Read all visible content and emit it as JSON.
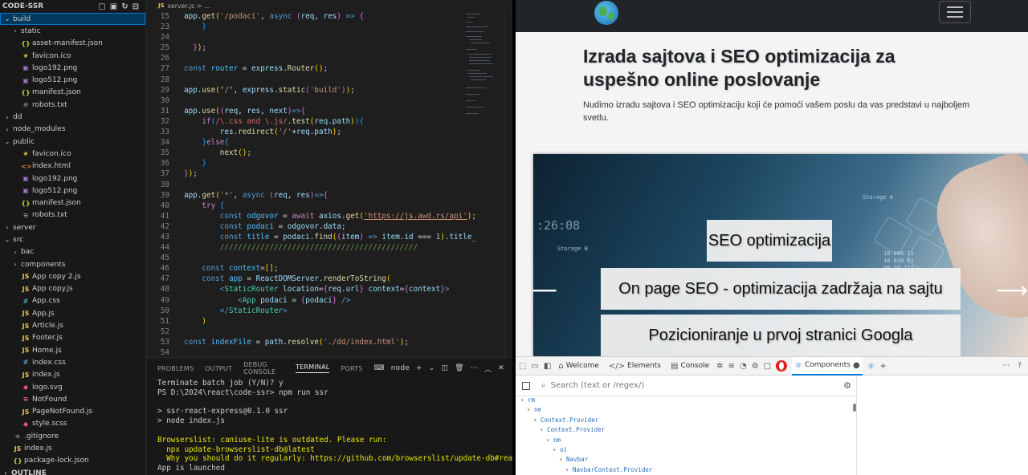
{
  "explorer": {
    "title": "CODE-SSR",
    "items": [
      {
        "depth": 0,
        "chev": "v",
        "icon": "",
        "label": "build",
        "selected": true
      },
      {
        "depth": 1,
        "chev": ">",
        "icon": "",
        "label": "static"
      },
      {
        "depth": 1,
        "chev": "",
        "icon": "{}",
        "cls": "ic-json",
        "label": "asset-manifest.json"
      },
      {
        "depth": 1,
        "chev": "",
        "icon": "★",
        "cls": "ic-star",
        "label": "favicon.ico"
      },
      {
        "depth": 1,
        "chev": "",
        "icon": "▣",
        "cls": "ic-img",
        "label": "logo192.png"
      },
      {
        "depth": 1,
        "chev": "",
        "icon": "▣",
        "cls": "ic-img",
        "label": "logo512.png"
      },
      {
        "depth": 1,
        "chev": "",
        "icon": "{}",
        "cls": "ic-json",
        "label": "manifest.json"
      },
      {
        "depth": 1,
        "chev": "",
        "icon": "≡",
        "cls": "ic-txt",
        "label": "robots.txt"
      },
      {
        "depth": 0,
        "chev": ">",
        "icon": "",
        "label": "dd"
      },
      {
        "depth": 0,
        "chev": ">",
        "icon": "",
        "label": "node_modules"
      },
      {
        "depth": 0,
        "chev": "v",
        "icon": "",
        "label": "public"
      },
      {
        "depth": 1,
        "chev": "",
        "icon": "★",
        "cls": "ic-star",
        "label": "favicon.ico"
      },
      {
        "depth": 1,
        "chev": "",
        "icon": "<>",
        "cls": "ic-html",
        "label": "index.html"
      },
      {
        "depth": 1,
        "chev": "",
        "icon": "▣",
        "cls": "ic-img",
        "label": "logo192.png"
      },
      {
        "depth": 1,
        "chev": "",
        "icon": "▣",
        "cls": "ic-img",
        "label": "logo512.png"
      },
      {
        "depth": 1,
        "chev": "",
        "icon": "{}",
        "cls": "ic-json",
        "label": "manifest.json"
      },
      {
        "depth": 1,
        "chev": "",
        "icon": "≡",
        "cls": "ic-txt",
        "label": "robots.txt"
      },
      {
        "depth": 0,
        "chev": ">",
        "icon": "",
        "label": "server"
      },
      {
        "depth": 0,
        "chev": "v",
        "icon": "",
        "label": "src"
      },
      {
        "depth": 1,
        "chev": ">",
        "icon": "",
        "label": "bac"
      },
      {
        "depth": 1,
        "chev": ">",
        "icon": "",
        "label": "components"
      },
      {
        "depth": 1,
        "chev": "",
        "icon": "JS",
        "cls": "ic-js",
        "label": "App copy 2.js"
      },
      {
        "depth": 1,
        "chev": "",
        "icon": "JS",
        "cls": "ic-js",
        "label": "App copy.js"
      },
      {
        "depth": 1,
        "chev": "",
        "icon": "#",
        "cls": "ic-css",
        "label": "App.css"
      },
      {
        "depth": 1,
        "chev": "",
        "icon": "JS",
        "cls": "ic-js",
        "label": "App.js"
      },
      {
        "depth": 1,
        "chev": "",
        "icon": "JS",
        "cls": "ic-js",
        "label": "Article.js"
      },
      {
        "depth": 1,
        "chev": "",
        "icon": "JS",
        "cls": "ic-js",
        "label": "Footer.js"
      },
      {
        "depth": 1,
        "chev": "",
        "icon": "JS",
        "cls": "ic-js",
        "label": "Home.js"
      },
      {
        "depth": 1,
        "chev": "",
        "icon": "#",
        "cls": "ic-css",
        "label": "index.css"
      },
      {
        "depth": 1,
        "chev": "",
        "icon": "JS",
        "cls": "ic-js",
        "label": "index.js"
      },
      {
        "depth": 1,
        "chev": "",
        "icon": "◆",
        "cls": "ic-scss",
        "label": "logo.svg"
      },
      {
        "depth": 1,
        "chev": "",
        "icon": "≡",
        "cls": "ic-red",
        "label": "NotFound"
      },
      {
        "depth": 1,
        "chev": "",
        "icon": "JS",
        "cls": "ic-js",
        "label": "PageNotFound.js"
      },
      {
        "depth": 1,
        "chev": "",
        "icon": "◆",
        "cls": "ic-scss",
        "label": "style.scss"
      },
      {
        "depth": 0,
        "chev": "",
        "icon": "◈",
        "cls": "ic-git",
        "label": ".gitignore"
      },
      {
        "depth": 0,
        "chev": "",
        "icon": "JS",
        "cls": "ic-js",
        "label": "index.js"
      },
      {
        "depth": 0,
        "chev": "",
        "icon": "{}",
        "cls": "ic-json",
        "label": "package-lock.json"
      },
      {
        "depth": -1,
        "chev": ">",
        "icon": "",
        "label": "OUTLINE"
      }
    ]
  },
  "editor": {
    "tab": "server.js > ...",
    "tab_badge": "JS",
    "line_numbers": [
      "15",
      "23",
      "24",
      "25",
      "26",
      "27",
      "28",
      "29",
      "30",
      "31",
      "32",
      "33",
      "34",
      "35",
      "36",
      "37",
      "38",
      "39",
      "40",
      "41",
      "42",
      "43",
      "44",
      "45",
      "46",
      "47",
      "48",
      "49",
      "50",
      "51",
      "52",
      "53",
      "54"
    ]
  },
  "panel": {
    "tabs": [
      "PROBLEMS",
      "OUTPUT",
      "DEBUG CONSOLE",
      "TERMINAL",
      "PORTS"
    ],
    "active_tab": "TERMINAL",
    "terminal_name": "node",
    "lines": [
      {
        "text": "Terminate batch job (Y/N)? y",
        "cls": ""
      },
      {
        "text": "PS D:\\2024\\react\\code-ssr> npm run ssr",
        "cls": ""
      },
      {
        "text": "",
        "cls": ""
      },
      {
        "text": "> ssr-react-express@0.1.0 ssr",
        "cls": ""
      },
      {
        "text": "> node index.js",
        "cls": ""
      },
      {
        "text": "",
        "cls": ""
      },
      {
        "text": "Browserslist: caniuse-lite is outdated. Please run:",
        "cls": "y"
      },
      {
        "text": "  npx update-browserslist-db@latest",
        "cls": "y"
      },
      {
        "text": "  Why you should do it regularly: https://github.com/browserslist/update-db#readme",
        "cls": "y"
      },
      {
        "text": "App is launched",
        "cls": ""
      }
    ]
  },
  "browser": {
    "title": "Izrada sajtova i SEO optimizacija za uspešno online poslovanje",
    "subtitle": "Nudimo izradu sajtova i SEO optimizaciju koji će pomoći vašem poslu da vas predstavi u najboljem svetlu.",
    "carousel": {
      "captions": [
        "SEO optimizacija",
        "On page SEO - optimizacija zadržaja na sajtu",
        "Pozicioniranje u prvoj stranici Googla"
      ],
      "clock": ":26:08",
      "storage_a": "Storage A",
      "storage_b": "Storage B",
      "binary": "10 000 11\n10 010 01\n00 10 111"
    }
  },
  "devtools": {
    "tabs": [
      "Welcome",
      "Elements",
      "Console",
      "Components"
    ],
    "active_tab": "Components",
    "search_placeholder": "Search (text or /regex/)",
    "tree": [
      {
        "indent": 0,
        "label": "rm"
      },
      {
        "indent": 1,
        "label": "ne"
      },
      {
        "indent": 2,
        "label": "Context.Provider"
      },
      {
        "indent": 3,
        "label": "Context.Provider"
      },
      {
        "indent": 4,
        "label": "nm"
      },
      {
        "indent": 5,
        "label": "oi"
      },
      {
        "indent": 6,
        "label": "Navbar"
      },
      {
        "indent": 7,
        "label": "NavbarContext.Provider"
      }
    ]
  },
  "colors": {
    "vscode_bg": "#1e1e1e",
    "selection": "#04395e",
    "navbar": "#212529",
    "devtools_accent": "#0078d4"
  }
}
